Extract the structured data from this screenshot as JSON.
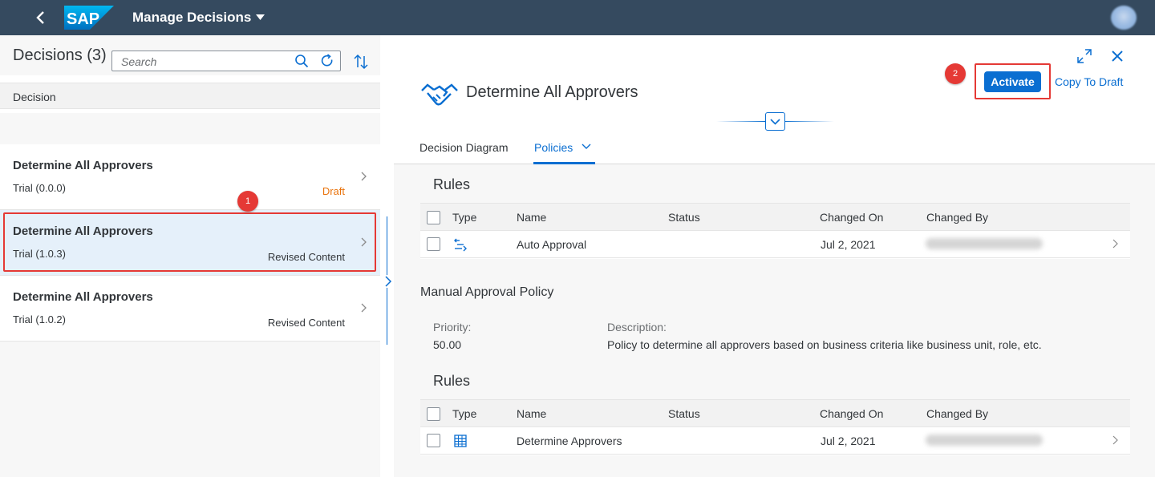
{
  "shell": {
    "app_title": "Manage Decisions",
    "logo_text": "SAP"
  },
  "master": {
    "title": "Decisions (3)",
    "search_placeholder": "Search",
    "column_header": "Decision",
    "items": [
      {
        "title": "Determine All Approvers",
        "version": "Trial (0.0.0)",
        "status": "Draft"
      },
      {
        "title": "Determine All Approvers",
        "version": "Trial (1.0.3)",
        "status": "Revised Content"
      },
      {
        "title": "Determine All Approvers",
        "version": "Trial (1.0.2)",
        "status": "Revised Content"
      }
    ]
  },
  "annotations": {
    "badge1": "1",
    "badge2": "2"
  },
  "detail": {
    "title": "Determine All Approvers",
    "activate_label": "Activate",
    "copy_label": "Copy To Draft",
    "tabs": [
      {
        "label": "Decision Diagram"
      },
      {
        "label": "Policies"
      }
    ],
    "rules1": {
      "title": "Rules",
      "columns": [
        "Type",
        "Name",
        "Status",
        "Changed On",
        "Changed By"
      ],
      "rows": [
        {
          "type_icon": "text-rule-icon",
          "name": "Auto Approval",
          "status": "",
          "changed_on": "Jul 2, 2021"
        }
      ]
    },
    "policy": {
      "name": "Manual Approval Policy",
      "priority_label": "Priority:",
      "priority_value": "50.00",
      "description_label": "Description:",
      "description_value": "Policy to determine all approvers based on business criteria like business unit, role, etc."
    },
    "rules2": {
      "title": "Rules",
      "columns": [
        "Type",
        "Name",
        "Status",
        "Changed On",
        "Changed By"
      ],
      "rows": [
        {
          "type_icon": "decision-table-icon",
          "name": "Determine Approvers",
          "status": "",
          "changed_on": "Jul 2, 2021"
        }
      ]
    }
  },
  "colors": {
    "shell": "#354a5f",
    "accent": "#0a6ed1",
    "draft": "#e9730c",
    "highlight": "#e53935"
  }
}
